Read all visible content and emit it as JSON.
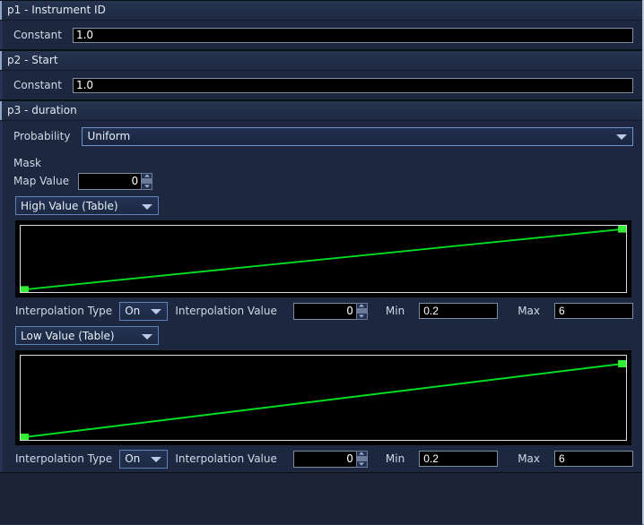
{
  "sections": [
    {
      "id": "p1",
      "header": "p1 - Instrument ID",
      "constant_label": "Constant",
      "constant_value": "1.0"
    },
    {
      "id": "p2",
      "header": "p2 - Start",
      "constant_label": "Constant",
      "constant_value": "1.0"
    }
  ],
  "p3": {
    "header": "p3 - duration",
    "probability_label": "Probability",
    "probability_value": "Uniform",
    "mask": {
      "title": "Mask",
      "map_value_label": "Map Value",
      "map_value": "0"
    },
    "high": {
      "table_select": "High Value (Table)",
      "interpolation_type_label": "Interpolation Type",
      "interpolation_type_value": "On",
      "interpolation_value_label": "Interpolation Value",
      "interpolation_value": "0",
      "min_label": "Min",
      "min_value": "0.2",
      "max_label": "Max",
      "max_value": "6"
    },
    "low": {
      "table_select": "Low Value (Table)",
      "interpolation_type_label": "Interpolation Type",
      "interpolation_type_value": "On",
      "interpolation_value_label": "Interpolation Value",
      "interpolation_value": "0",
      "min_label": "Min",
      "min_value": "0.2",
      "max_label": "Max",
      "max_value": "6"
    }
  },
  "colors": {
    "curve": "#00dd22",
    "handle": "#33ee33",
    "graph_border": "#d8dbe0",
    "graph_bg": "#000000",
    "panel_bg": "#1d2840",
    "accent": "#6d93cf"
  },
  "chart_data": [
    {
      "type": "line",
      "name": "high-value-envelope",
      "x": [
        0,
        1
      ],
      "y": [
        0.02,
        0.93
      ],
      "xlim": [
        0,
        1
      ],
      "ylim": [
        0,
        1
      ],
      "grid": false,
      "legend": null,
      "title": "",
      "xlabel": "",
      "ylabel": ""
    },
    {
      "type": "line",
      "name": "low-value-envelope",
      "x": [
        0,
        1
      ],
      "y": [
        0.02,
        0.9
      ],
      "xlim": [
        0,
        1
      ],
      "ylim": [
        0,
        1
      ],
      "grid": false,
      "legend": null,
      "title": "",
      "xlabel": "",
      "ylabel": ""
    }
  ]
}
